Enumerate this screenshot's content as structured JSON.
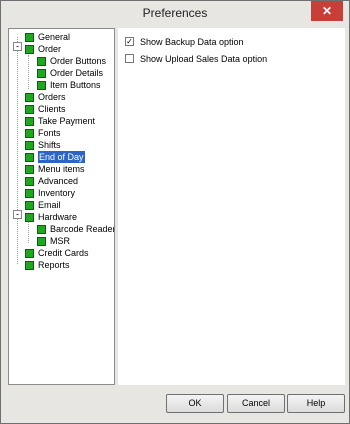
{
  "window": {
    "title": "Preferences"
  },
  "tree": {
    "items": [
      {
        "label": "General"
      },
      {
        "label": "Order"
      },
      {
        "label": "Order Buttons"
      },
      {
        "label": "Order Details"
      },
      {
        "label": "Item Buttons"
      },
      {
        "label": "Orders"
      },
      {
        "label": "Clients"
      },
      {
        "label": "Take Payment"
      },
      {
        "label": "Fonts"
      },
      {
        "label": "Shifts"
      },
      {
        "label": "End of Day",
        "selected": true
      },
      {
        "label": "Menu items"
      },
      {
        "label": "Advanced"
      },
      {
        "label": "Inventory"
      },
      {
        "label": "Email"
      },
      {
        "label": "Hardware"
      },
      {
        "label": "Barcode Reader"
      },
      {
        "label": "MSR"
      },
      {
        "label": "Credit Cards"
      },
      {
        "label": "Reports"
      }
    ]
  },
  "options": [
    {
      "label": "Show Backup Data option",
      "checked": true
    },
    {
      "label": "Show Upload Sales Data option",
      "checked": false
    }
  ],
  "buttons": {
    "ok": "OK",
    "cancel": "Cancel",
    "help": "Help"
  }
}
